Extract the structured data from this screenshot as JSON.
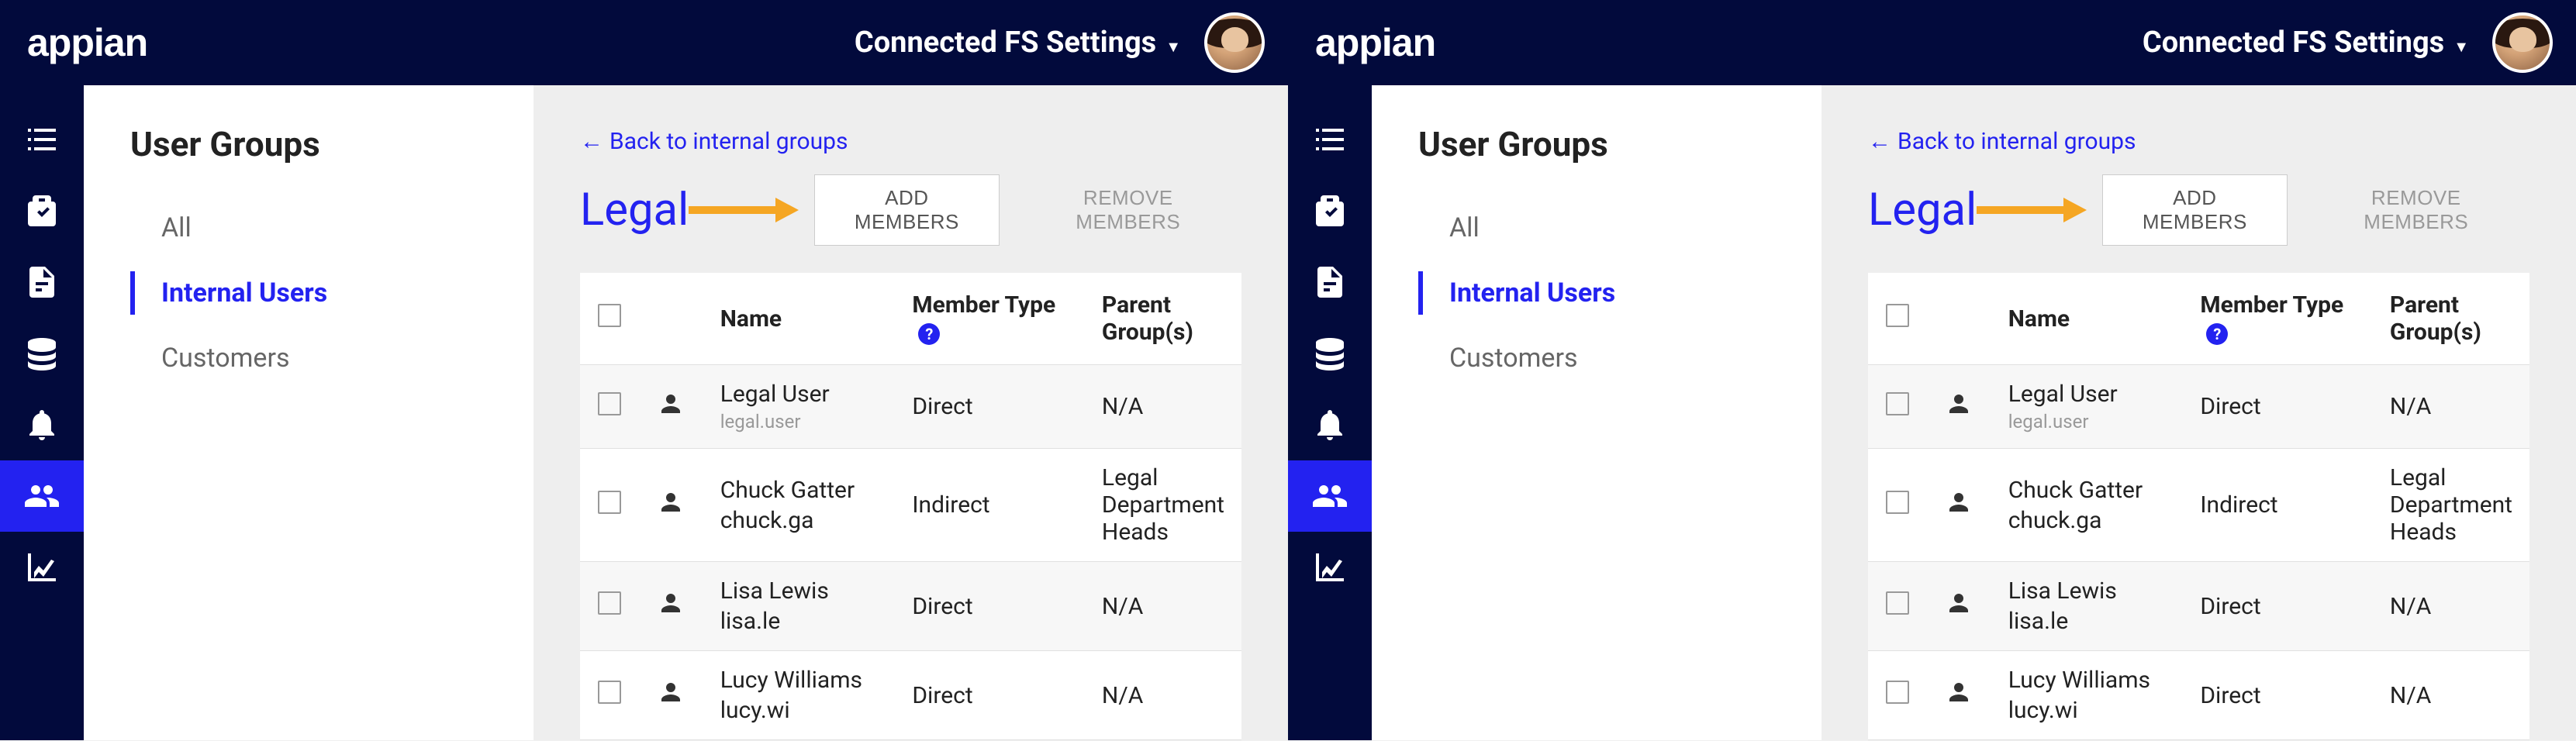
{
  "header": {
    "logo": "appian",
    "settings_label": "Connected FS Settings"
  },
  "nav": {
    "items": [
      {
        "name": "tasks",
        "active": false
      },
      {
        "name": "clipboard",
        "active": false
      },
      {
        "name": "document",
        "active": false
      },
      {
        "name": "database",
        "active": false
      },
      {
        "name": "notifications",
        "active": false
      },
      {
        "name": "users",
        "active": true
      },
      {
        "name": "analytics",
        "active": false
      }
    ]
  },
  "sidebar": {
    "title": "User Groups",
    "items": [
      {
        "label": "All",
        "active": false
      },
      {
        "label": "Internal Users",
        "active": true
      },
      {
        "label": "Customers",
        "active": false
      }
    ]
  },
  "content": {
    "back_link": "Back to internal groups",
    "title": "Legal",
    "add_button": "ADD MEMBERS",
    "remove_button": "REMOVE MEMBERS",
    "columns": {
      "name": "Name",
      "member_type": "Member Type",
      "parent_groups": "Parent Group(s)"
    },
    "rows": [
      {
        "name": "Legal User",
        "username": "legal.user",
        "username_muted": true,
        "member_type": "Direct",
        "parent_groups": "N/A"
      },
      {
        "name": "Chuck Gatter",
        "username": "chuck.ga",
        "username_muted": false,
        "member_type": "Indirect",
        "parent_groups": "Legal Department Heads"
      },
      {
        "name": "Lisa Lewis",
        "username": "lisa.le",
        "username_muted": false,
        "member_type": "Direct",
        "parent_groups": "N/A"
      },
      {
        "name": "Lucy Williams",
        "username": "lucy.wi",
        "username_muted": false,
        "member_type": "Direct",
        "parent_groups": "N/A"
      }
    ]
  }
}
